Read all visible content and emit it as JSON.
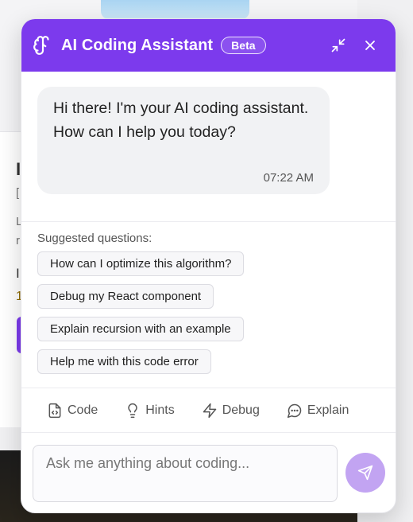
{
  "header": {
    "title": "AI Coding Assistant",
    "badge": "Beta",
    "icons": [
      "brain-icon",
      "minimize-icon",
      "close-icon"
    ]
  },
  "messages": [
    {
      "text": "Hi there! I'm your AI coding assistant. How can I help you today?",
      "time": "07:22 AM"
    }
  ],
  "suggested": {
    "label": "Suggested questions:",
    "items": [
      "How can I optimize this algorithm?",
      "Debug my React component",
      "Explain recursion with an example",
      "Help me with this code error"
    ]
  },
  "tools": [
    {
      "label": "Code",
      "icon": "code-file-icon"
    },
    {
      "label": "Hints",
      "icon": "lightbulb-icon"
    },
    {
      "label": "Debug",
      "icon": "lightning-icon"
    },
    {
      "label": "Explain",
      "icon": "message-circle-icon"
    }
  ],
  "composer": {
    "placeholder": "Ask me anything about coding...",
    "send_icon": "send-icon"
  },
  "colors": {
    "accent": "#7c3aed",
    "send_disabled": "#c2a4f2"
  }
}
